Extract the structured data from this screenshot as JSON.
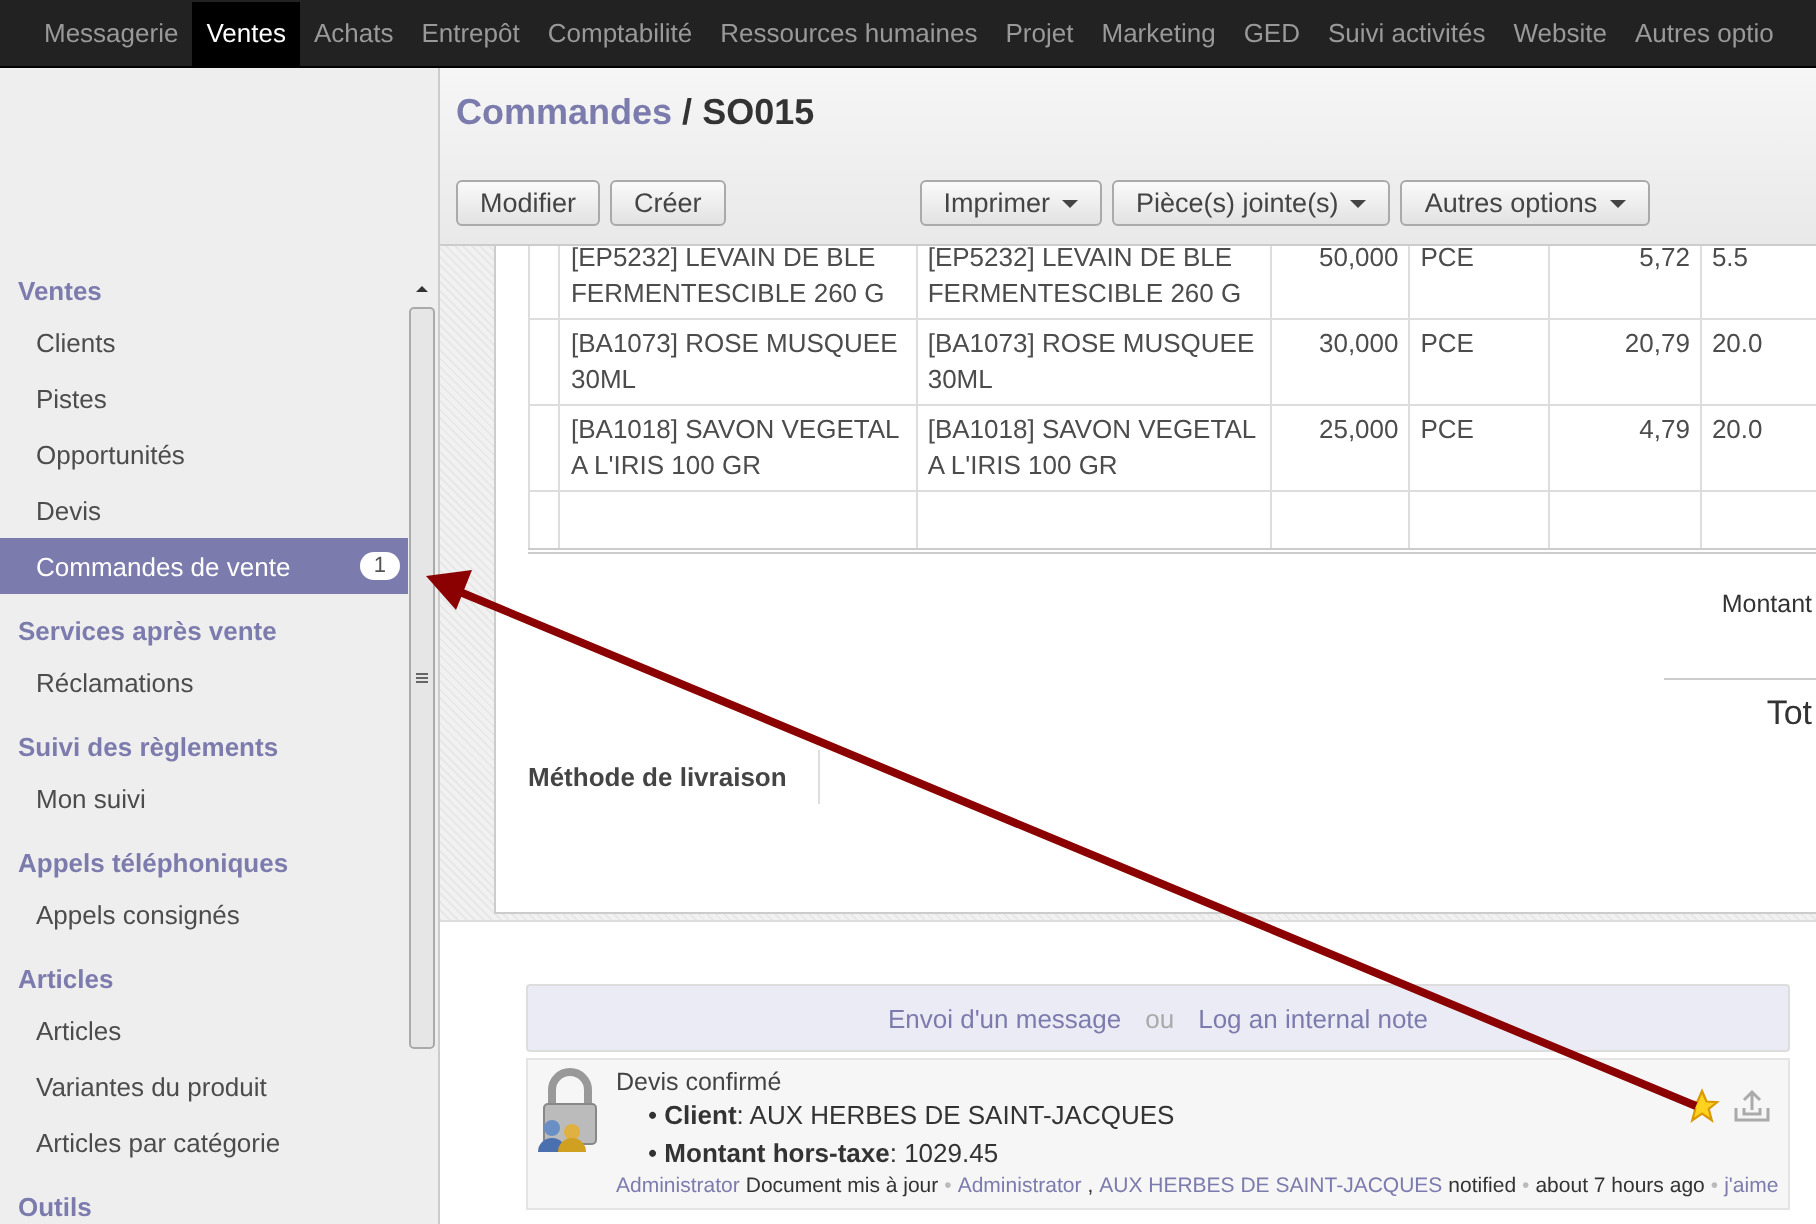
{
  "top_menu": [
    {
      "label": "Messagerie",
      "selected": false
    },
    {
      "label": "Ventes",
      "selected": true
    },
    {
      "label": "Achats",
      "selected": false
    },
    {
      "label": "Entrepôt",
      "selected": false
    },
    {
      "label": "Comptabilité",
      "selected": false
    },
    {
      "label": "Ressources humaines",
      "selected": false
    },
    {
      "label": "Projet",
      "selected": false
    },
    {
      "label": "Marketing",
      "selected": false
    },
    {
      "label": "GED",
      "selected": false
    },
    {
      "label": "Suivi activités",
      "selected": false
    },
    {
      "label": "Website",
      "selected": false
    },
    {
      "label": "Autres optio",
      "selected": false
    }
  ],
  "sidebar": {
    "sections": [
      {
        "title": "Ventes",
        "items": [
          {
            "label": "Clients",
            "selected": false
          },
          {
            "label": "Pistes",
            "selected": false
          },
          {
            "label": "Opportunités",
            "selected": false
          },
          {
            "label": "Devis",
            "selected": false
          },
          {
            "label": "Commandes de vente",
            "selected": true,
            "badge": "1"
          }
        ]
      },
      {
        "title": "Services après vente",
        "items": [
          {
            "label": "Réclamations",
            "selected": false
          }
        ]
      },
      {
        "title": "Suivi des règlements",
        "items": [
          {
            "label": "Mon suivi",
            "selected": false
          }
        ]
      },
      {
        "title": "Appels téléphoniques",
        "items": [
          {
            "label": "Appels consignés",
            "selected": false
          }
        ]
      },
      {
        "title": "Articles",
        "items": [
          {
            "label": "Articles",
            "selected": false
          },
          {
            "label": "Variantes du produit",
            "selected": false
          },
          {
            "label": "Articles par catégorie",
            "selected": false
          }
        ]
      },
      {
        "title": "Outils"
      }
    ]
  },
  "breadcrumb": {
    "parent": "Commandes",
    "separator": "/",
    "current": "SO015"
  },
  "toolbar": [
    {
      "label": "Modifier",
      "kind": "plain"
    },
    {
      "label": "Créer",
      "kind": "plain"
    },
    {
      "label": "Imprimer",
      "kind": "dropdown"
    },
    {
      "label": "Pièce(s) jointe(s)",
      "kind": "dropdown"
    },
    {
      "label": "Autres options",
      "kind": "dropdown"
    }
  ],
  "order_lines": {
    "rows": [
      {
        "cells": [
          "[EP5232] LEVAIN DE BLE FERMENTESCIBLE 260 G",
          "[EP5232] LEVAIN DE BLE FERMENTESCIBLE 260 G",
          "50,000",
          "PCE",
          "5,72",
          "5.5"
        ]
      },
      {
        "cells": [
          "[BA1073] ROSE MUSQUEE 30ML",
          "[BA1073] ROSE MUSQUEE 30ML",
          "30,000",
          "PCE",
          "20,79",
          "20.0"
        ]
      },
      {
        "cells": [
          "[BA1018] SAVON VEGETAL A L'IRIS 100 GR",
          "[BA1018] SAVON VEGETAL A L'IRIS 100 GR",
          "25,000",
          "PCE",
          "4,79",
          "20.0"
        ]
      }
    ]
  },
  "totals": {
    "amount_label": "Montant",
    "total_label": "Tot"
  },
  "delivery_label": "Méthode de livraison",
  "chatter": {
    "composer": {
      "send_message": "Envoi d'un message",
      "or": "ou",
      "log_note": "Log an internal note"
    },
    "message": {
      "title": "Devis confirmé",
      "starred": true,
      "lines": [
        "• **Client**: AUX HERBES DE SAINT-JACQUES",
        "• **Montant hors-taxe**: 1029.45"
      ],
      "footer": [
        {
          "kind": "link",
          "text": "Administrator"
        },
        {
          "kind": "text",
          "text": "Document mis à jour"
        },
        {
          "kind": "sep",
          "text": "•"
        },
        {
          "kind": "link",
          "text": "Administrator"
        },
        {
          "kind": "text",
          "text": ","
        },
        {
          "kind": "link",
          "text": "AUX HERBES DE SAINT-JACQUES"
        },
        {
          "kind": "text",
          "text": "notified"
        },
        {
          "kind": "sep",
          "text": "•"
        },
        {
          "kind": "text",
          "text": "about 7 hours ago"
        },
        {
          "kind": "sep",
          "text": "•"
        },
        {
          "kind": "link",
          "text": "j'aime"
        }
      ]
    }
  }
}
